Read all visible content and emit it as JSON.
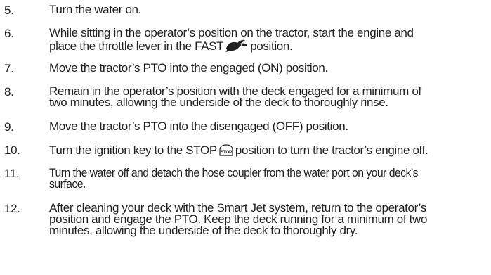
{
  "steps": [
    {
      "number": "5.",
      "lines": [
        "Turn the water on."
      ]
    },
    {
      "number": "6.",
      "lines": [
        "While sitting in the operator’s position on the tractor, start the engine and",
        "place the throttle lever in the FAST",
        "position."
      ]
    },
    {
      "number": "7.",
      "lines": [
        "Move the tractor’s PTO into the engaged (ON) position."
      ]
    },
    {
      "number": "8.",
      "lines": [
        "Remain in the operator’s position with the deck engaged for a minimum of",
        "two minutes, allowing the underside of the deck to thoroughly rinse."
      ]
    },
    {
      "number": "9.",
      "lines": [
        "Move the tractor’s PTO into the disengaged (OFF) position."
      ]
    },
    {
      "number": "10.",
      "lines": [
        "Turn the ignition key to the STOP",
        "position to turn the tractor’s engine off."
      ]
    },
    {
      "number": "11.",
      "lines": [
        "Turn the water off and detach the hose coupler from the water port on your deck’s",
        "surface."
      ]
    },
    {
      "number": "12.",
      "lines": [
        "After cleaning your deck with the Smart Jet system, return to the operator’s",
        "position and engage the PTO. Keep the deck running for a minimum of two",
        "minutes, allowing the underside of the deck to thoroughly dry."
      ]
    }
  ],
  "icons": {
    "fast": "rabbit-icon",
    "stop": "stop-icon",
    "stop_text": "STOP"
  }
}
